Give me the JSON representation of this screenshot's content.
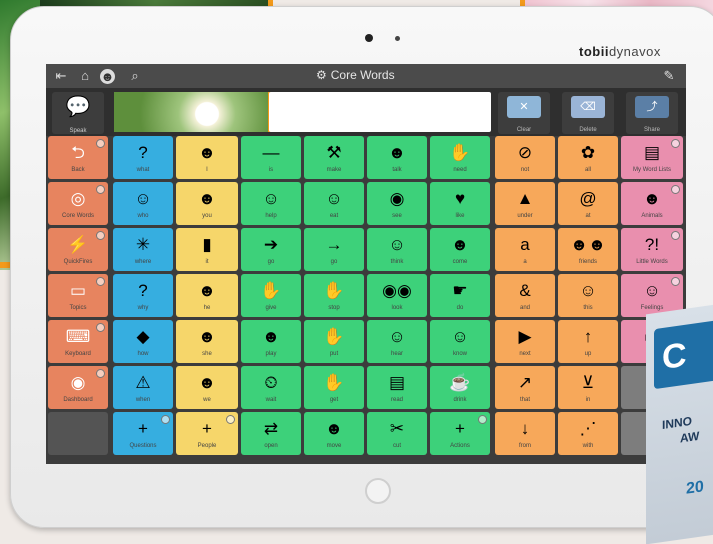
{
  "brand": {
    "name_bold": "tobii",
    "name_rest": "dynavox"
  },
  "topbar": {
    "title": "Core Words",
    "icons": [
      "exit-icon",
      "home-icon",
      "profile-icon",
      "search-icon",
      "settings-icon",
      "edit-off-icon"
    ]
  },
  "message": {
    "speak_label": "Speak",
    "clear_label": "Clear",
    "delete_label": "Delete",
    "share_label": "Share"
  },
  "colors": {
    "navigation": "#e7845f",
    "question": "#36aee0",
    "pronoun": "#f6d66a",
    "verb": "#3dd17a",
    "misc": "#f7a85a",
    "folder": "#e98fae"
  },
  "grid": {
    "left_column": [
      {
        "label": "Back",
        "icon": "back-arrow-icon"
      },
      {
        "label": "Core Words",
        "icon": "core-target-icon"
      },
      {
        "label": "QuickFires",
        "icon": "quickfires-icon"
      },
      {
        "label": "Topics",
        "icon": "topics-chat-icon"
      },
      {
        "label": "Keyboard",
        "icon": "keyboard-icon"
      },
      {
        "label": "Dashboard",
        "icon": "dashboard-icon"
      }
    ],
    "question_column": [
      {
        "label": "what",
        "icon": "question-box-icon"
      },
      {
        "label": "who",
        "icon": "who-head-icon"
      },
      {
        "label": "where",
        "icon": "where-arrows-icon"
      },
      {
        "label": "why",
        "icon": "why-question-icon"
      },
      {
        "label": "how",
        "icon": "how-diamond-icon"
      },
      {
        "label": "when",
        "icon": "warning-triangle-icon"
      },
      {
        "label": "Questions",
        "icon": "plus-icon"
      }
    ],
    "pronoun_column": [
      {
        "label": "I",
        "icon": "person-icon"
      },
      {
        "label": "you",
        "icon": "person-icon"
      },
      {
        "label": "it",
        "icon": "object-icon"
      },
      {
        "label": "he",
        "icon": "person-icon"
      },
      {
        "label": "she",
        "icon": "person-icon"
      },
      {
        "label": "we",
        "icon": "group-icon"
      },
      {
        "label": "People",
        "icon": "plus-icon"
      }
    ],
    "verb_rows": [
      [
        {
          "label": "is",
          "icon": "dash-icon"
        },
        {
          "label": "make",
          "icon": "make-icon"
        },
        {
          "label": "talk",
          "icon": "talk-icon"
        },
        {
          "label": "need",
          "icon": "need-icon"
        }
      ],
      [
        {
          "label": "help",
          "icon": "help-icon"
        },
        {
          "label": "eat",
          "icon": "eat-icon"
        },
        {
          "label": "see",
          "icon": "see-icon"
        },
        {
          "label": "like",
          "icon": "like-icon"
        }
      ],
      [
        {
          "label": "go",
          "icon": "go-icon"
        },
        {
          "label": "go",
          "icon": "arrow-right-icon"
        },
        {
          "label": "think",
          "icon": "think-icon"
        },
        {
          "label": "come",
          "icon": "come-icon"
        }
      ],
      [
        {
          "label": "give",
          "icon": "give-icon"
        },
        {
          "label": "stop",
          "icon": "stop-hand-icon"
        },
        {
          "label": "look",
          "icon": "look-eyes-icon"
        },
        {
          "label": "do",
          "icon": "do-icon"
        }
      ],
      [
        {
          "label": "play",
          "icon": "play-icon"
        },
        {
          "label": "put",
          "icon": "put-icon"
        },
        {
          "label": "hear",
          "icon": "hear-icon"
        },
        {
          "label": "know",
          "icon": "know-icon"
        }
      ],
      [
        {
          "label": "wait",
          "icon": "clock-icon"
        },
        {
          "label": "get",
          "icon": "get-icon"
        },
        {
          "label": "read",
          "icon": "read-icon"
        },
        {
          "label": "drink",
          "icon": "drink-icon"
        }
      ],
      [
        {
          "label": "open",
          "icon": "open-icon"
        },
        {
          "label": "move",
          "icon": "move-icon"
        },
        {
          "label": "cut",
          "icon": "cut-icon"
        },
        {
          "label": "Actions",
          "icon": "plus-icon"
        }
      ]
    ],
    "misc_rows": [
      [
        {
          "label": "not",
          "icon": "no-symbol-icon"
        },
        {
          "label": "all",
          "icon": "all-icon"
        }
      ],
      [
        {
          "label": "under",
          "icon": "under-icon"
        },
        {
          "label": "at",
          "icon": "at-icon"
        }
      ],
      [
        {
          "label": "a",
          "icon": "letter-a-icon"
        },
        {
          "label": "friends",
          "icon": "friends-icon"
        }
      ],
      [
        {
          "label": "and",
          "icon": "ampersand-icon"
        },
        {
          "label": "this",
          "icon": "this-icon"
        }
      ],
      [
        {
          "label": "next",
          "icon": "play-triangle-icon"
        },
        {
          "label": "up",
          "icon": "up-icon"
        }
      ],
      [
        {
          "label": "that",
          "icon": "point-icon"
        },
        {
          "label": "in",
          "icon": "in-icon"
        }
      ],
      [
        {
          "label": "from",
          "icon": "from-icon"
        },
        {
          "label": "with",
          "icon": "with-icon"
        }
      ]
    ],
    "folder_column": [
      {
        "label": "My Word Lists",
        "icon": "word-list-icon"
      },
      {
        "label": "Animals",
        "icon": "animal-icon"
      },
      {
        "label": "Little Words",
        "icon": "little-words-icon"
      },
      {
        "label": "Feelings",
        "icon": "feelings-icon"
      },
      {
        "label": "",
        "icon": "folder-icon"
      }
    ]
  },
  "badge": {
    "initial": "C",
    "line1": "INNO",
    "line2": "AW",
    "year": "20"
  }
}
